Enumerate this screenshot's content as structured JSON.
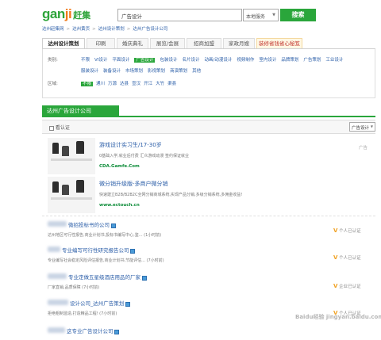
{
  "header": {
    "logo_main": "gan",
    "logo_o": "ji",
    "logo_sub": "赶集",
    "search_value": "广告设计",
    "search_scope": "本地服务",
    "search_button": "搜索"
  },
  "breadcrumb": [
    "达州赶集网",
    "达州黄页",
    "达州设计策划",
    "达州广告设计公司"
  ],
  "breadcrumb_sep": ">",
  "tabs": [
    {
      "label": "达州设计策划",
      "active": true
    },
    {
      "label": "印刷"
    },
    {
      "label": "婚庆典礼"
    },
    {
      "label": "展览/会展"
    },
    {
      "label": "招商加盟"
    },
    {
      "label": "家政月嫂"
    },
    {
      "label": "装修省钱省心秘笈",
      "special": true
    }
  ],
  "filters": {
    "category_label": "类别:",
    "category_row1": [
      "不限",
      "VI设计",
      "平面设计",
      "广告设计",
      "包装设计",
      "名片设计",
      "动画/动漫设计",
      "视频制作",
      "室内设计",
      "品牌策划",
      "广告策划",
      "工业设计"
    ],
    "category_row2": [
      "服装设计",
      "装备设计",
      "市场策划",
      "影视策划",
      "商演策划",
      "其他"
    ],
    "selected_category": "广告设计",
    "area_label": "区域:",
    "areas": [
      "不限",
      "通川",
      "万源",
      "达县",
      "宣汉",
      "开江",
      "大竹",
      "渠县"
    ],
    "selected_area": "不限"
  },
  "section_title": "达州广告设计公司",
  "sort": {
    "checkbox_label": "看认证",
    "select_value": "广告设计"
  },
  "ads": [
    {
      "title": "游戏设计实习生/17-30岁",
      "desc": "0基础入学,就业后付费 汇众游戏动漫 签约保证就业",
      "url": "CDA.Gamfe.Com",
      "badge": "广告"
    },
    {
      "title": "微分销升级版-多商户微分销",
      "desc": "快速建立B2B/B2B2C全网分销商城系统,实现产品分销,多级分销系统,多佣金收益!",
      "url": "www.ectouch.cn",
      "badge": ""
    }
  ],
  "listings": [
    {
      "title": "微招投标书的公司",
      "desc": "达州地区可行性报告,商业计划书,投标书编写中心,鉴... (1小时前)",
      "auth": "个人已认证",
      "has_tag": true
    },
    {
      "title": "专业编写可行性研究报告公司",
      "desc": "专业编写社会稳定风险评估报告,商业计划书,节能评估... (7小时前)",
      "auth": "个人已认证",
      "has_tag": true
    },
    {
      "title": "专业定做五星级酒店用品的厂家",
      "desc": "厂家直销,品质保障 (7小时前)",
      "auth": "企业已认证",
      "has_tag": true
    },
    {
      "title": "设计公司_达州广告策划",
      "desc": "拒绝粗制滥造,打造精品工程! (7小时前)",
      "auth": "个人已认证",
      "has_tag": true
    },
    {
      "title": "这专业广告设计公司",
      "desc": "",
      "auth": "",
      "has_tag": true
    }
  ],
  "watermark": "Baidu经验 jingyan.baidu.com",
  "colors": {
    "brand_green": "#2aa63b",
    "link_blue": "#2b5ea8",
    "url_green": "#0d8c39",
    "accent_orange": "#f07a1a"
  }
}
